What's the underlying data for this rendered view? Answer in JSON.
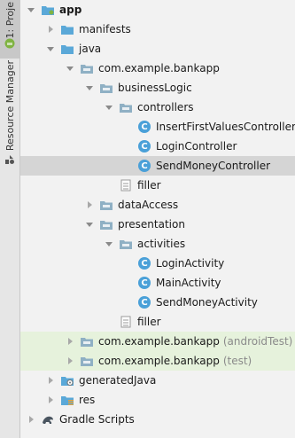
{
  "sidebar": {
    "project_tab_label": "1: Proje",
    "resource_tab_label": "Resource Manager"
  },
  "tree": {
    "nodes": [
      {
        "label": "app",
        "bold": true
      },
      {
        "label": "manifests"
      },
      {
        "label": "java"
      },
      {
        "label": "com.example.bankapp"
      },
      {
        "label": "businessLogic"
      },
      {
        "label": "controllers"
      },
      {
        "label": "InsertFirstValuesController"
      },
      {
        "label": "LoginController"
      },
      {
        "label": "SendMoneyController",
        "selected": true
      },
      {
        "label": "filler"
      },
      {
        "label": "dataAccess"
      },
      {
        "label": "presentation"
      },
      {
        "label": "activities"
      },
      {
        "label": "LoginActivity"
      },
      {
        "label": "MainActivity"
      },
      {
        "label": "SendMoneyActivity"
      },
      {
        "label": "filler"
      },
      {
        "label": "com.example.bankapp",
        "suffix": "(androidTest)"
      },
      {
        "label": "com.example.bankapp",
        "suffix": "(test)"
      },
      {
        "label": "generatedJava"
      },
      {
        "label": "res"
      },
      {
        "label": "Gradle Scripts"
      }
    ]
  },
  "colors": {
    "selection": "#d5d5d5",
    "test_tint": "#e6f2dc",
    "class_icon": "#4aa0d8",
    "folder": "#5aa8d8",
    "package": "#8fb0c4"
  }
}
